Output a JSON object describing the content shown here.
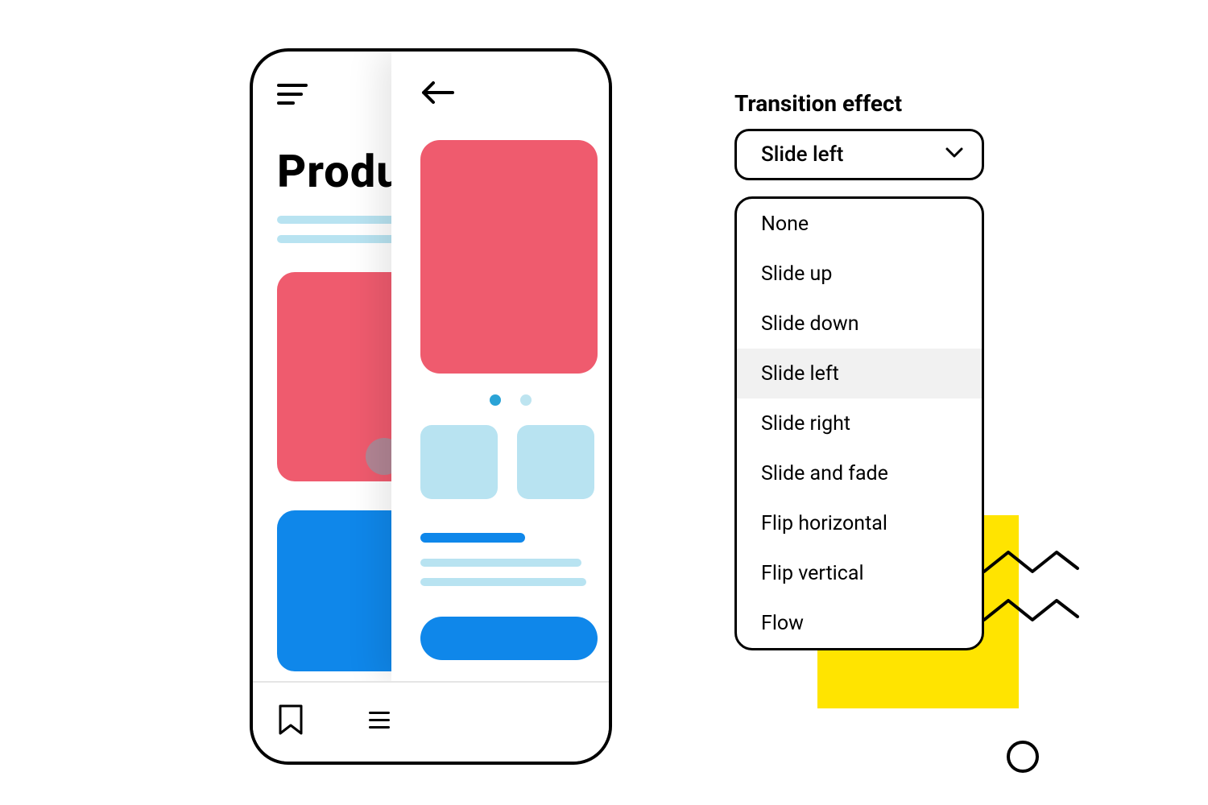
{
  "mock": {
    "back_title": "Produ"
  },
  "panel": {
    "label": "Transition effect",
    "selected": "Slide left",
    "options": [
      "None",
      "Slide up",
      "Slide down",
      "Slide left",
      "Slide right",
      "Slide and fade",
      "Flip horizontal",
      "Flip vertical",
      "Flow"
    ]
  },
  "colors": {
    "red": "#ef5b6e",
    "blue": "#0f87ea",
    "light_blue": "#b8e3f1",
    "yellow": "#ffe400"
  }
}
